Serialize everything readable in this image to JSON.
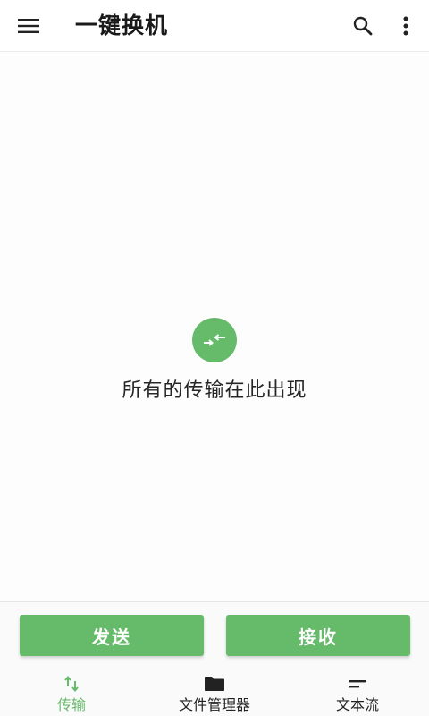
{
  "header": {
    "title": "一键换机",
    "menu_icon": "menu-icon",
    "search_icon": "search-icon",
    "more_icon": "more-vert-icon"
  },
  "empty_state": {
    "icon": "transfer-arrows-icon",
    "message": "所有的传输在此出现"
  },
  "actions": {
    "send_label": "发送",
    "receive_label": "接收"
  },
  "bottom_nav": {
    "items": [
      {
        "label": "传输",
        "icon": "transfer-icon",
        "selected": true
      },
      {
        "label": "文件管理器",
        "icon": "folder-icon",
        "selected": false
      },
      {
        "label": "文本流",
        "icon": "text-lines-icon",
        "selected": false
      }
    ]
  },
  "colors": {
    "accent": "#66bb6a",
    "text": "#212121",
    "background": "#fdfdfd"
  }
}
